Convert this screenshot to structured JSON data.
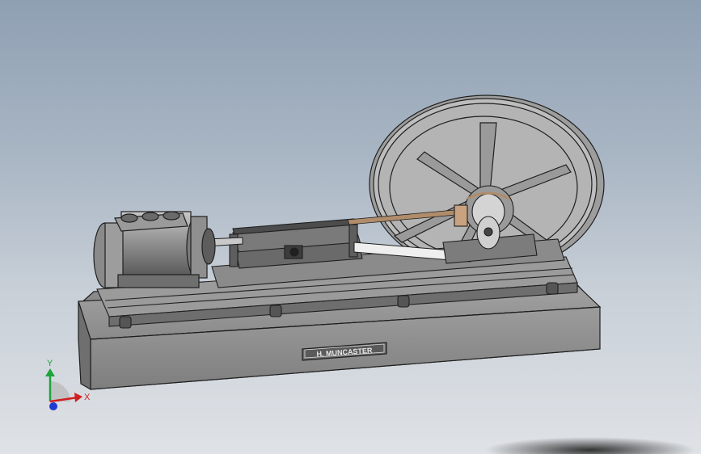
{
  "nameplate": {
    "text": "H. MUNCASTER"
  },
  "triad": {
    "x_label": "X",
    "y_label": "Y"
  },
  "colors": {
    "model_body": "#8e8e8e",
    "model_dark": "#5a5a5a",
    "edge": "#1f1f1f",
    "rod_highlight": "#eeeeee",
    "connecting_rod": "#b08c6a",
    "x_axis": "#d11f1f",
    "y_axis": "#1fa33a",
    "z_axis": "#1f3ad1"
  }
}
